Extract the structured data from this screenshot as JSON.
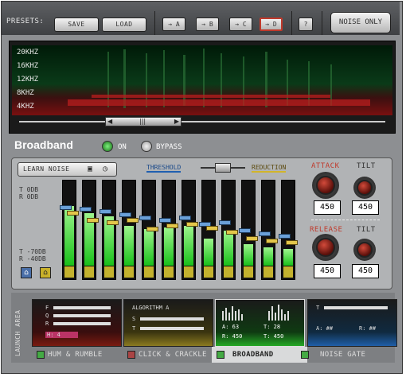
{
  "toolbar": {
    "presets_label": "PRESETS:",
    "save_label": "SAVE",
    "load_label": "LOAD",
    "presets": [
      {
        "label": "→ A",
        "active": false
      },
      {
        "label": "→ B",
        "active": false
      },
      {
        "label": "→ C",
        "active": false
      },
      {
        "label": "→ D",
        "active": true
      }
    ],
    "help_label": "?",
    "noise_only_label": "NOISE ONLY"
  },
  "spectrogram": {
    "freq_labels": [
      "20KHZ",
      "16KHZ",
      "12KHZ",
      "8KHZ",
      "4KHZ"
    ]
  },
  "broadband": {
    "title": "Broadband",
    "on_label": "ON",
    "bypass_label": "BYPASS",
    "learn_label": "LEARN NOISE",
    "threshold_label": "THRESHOLD",
    "reduction_label": "REDUCTION",
    "top_t": "T    0DB",
    "top_r": "R    0DB",
    "bot_t": "T  -70DB",
    "bot_r": "R  -40DB",
    "bands": [
      {
        "level": 0.72,
        "t": 0.7,
        "r": 0.63
      },
      {
        "level": 0.63,
        "t": 0.68,
        "r": 0.55
      },
      {
        "level": 0.6,
        "t": 0.65,
        "r": 0.52
      },
      {
        "level": 0.48,
        "t": 0.62,
        "r": 0.55
      },
      {
        "level": 0.44,
        "t": 0.58,
        "r": 0.44
      },
      {
        "level": 0.46,
        "t": 0.55,
        "r": 0.48
      },
      {
        "level": 0.48,
        "t": 0.58,
        "r": 0.5
      },
      {
        "level": 0.33,
        "t": 0.5,
        "r": 0.45
      },
      {
        "level": 0.42,
        "t": 0.52,
        "r": 0.4
      },
      {
        "level": 0.26,
        "t": 0.42,
        "r": 0.33
      },
      {
        "level": 0.22,
        "t": 0.38,
        "r": 0.3
      },
      {
        "level": 0.2,
        "t": 0.36,
        "r": 0.28
      }
    ],
    "attack_label": "ATTACK",
    "attack_value": "450",
    "tilt1_label": "TILT",
    "tilt1_value": "450",
    "release_label": "RELEASE",
    "release_value": "450",
    "tilt2_label": "TILT",
    "tilt2_value": "450"
  },
  "launch": {
    "label": "LAUNCH AREA",
    "modules": [
      {
        "name": "HUM & RUMBLE",
        "lines": [
          "F",
          "Q",
          "R",
          "H: 4"
        ]
      },
      {
        "name": "CLICK & CRACKLE",
        "lines": [
          "ALGORITHM A",
          "S",
          "T"
        ]
      },
      {
        "name": "BROADBAND",
        "lines": [
          "A: 63",
          "T: 28",
          "R: 450",
          "T: 450"
        ]
      },
      {
        "name": "NOISE GATE",
        "lines": [
          "T",
          "A: ##",
          "R: ##"
        ]
      }
    ]
  }
}
